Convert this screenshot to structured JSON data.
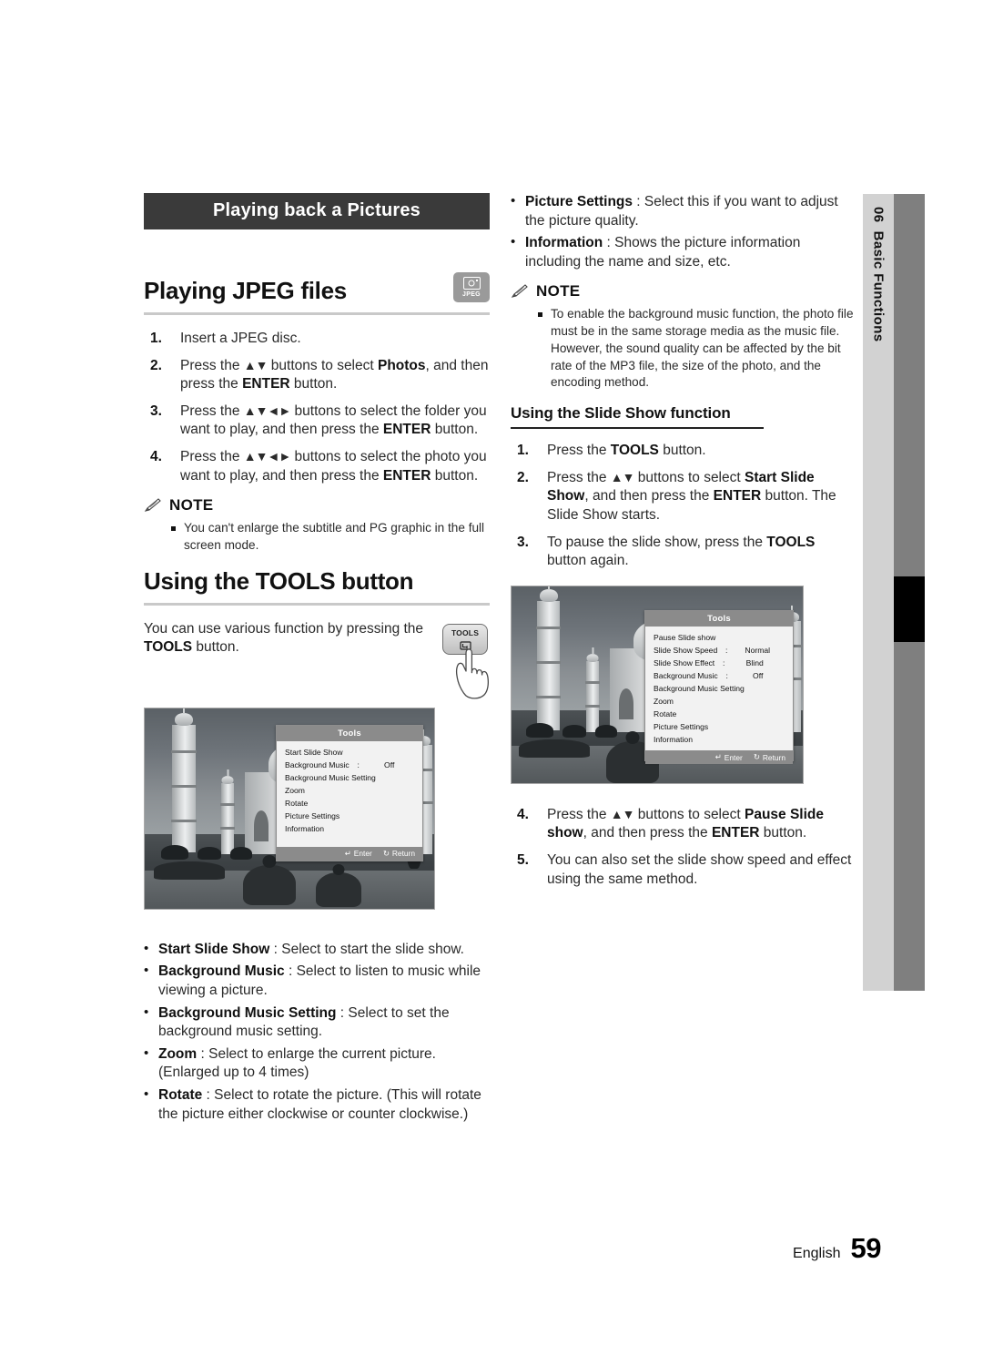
{
  "page": {
    "language_label": "English",
    "page_number": "59"
  },
  "side_tab": {
    "chapter_number": "06",
    "chapter_title": "Basic Functions"
  },
  "left_column": {
    "banner_title": "Playing back a Pictures",
    "format_badge": {
      "icon": "camera-icon",
      "label": "JPEG"
    },
    "heading_jpeg": "Playing JPEG files",
    "jpeg_steps": [
      {
        "num": "1.",
        "html": "Insert a JPEG disc."
      },
      {
        "num": "2.",
        "html": "Press the <span class=\"arrows\">▲▼</span> buttons to select <b>Photos</b>, and then press the <b>ENTER</b> button."
      },
      {
        "num": "3.",
        "html": "Press the <span class=\"arrows\">▲▼◄►</span> buttons to select the folder you want to play, and then press the <b>ENTER</b> button."
      },
      {
        "num": "4.",
        "html": "Press the <span class=\"arrows\">▲▼◄►</span> buttons to select the photo you want to play, and then press the <b>ENTER</b> button."
      }
    ],
    "note_label": "NOTE",
    "note_items": [
      "You can't enlarge the subtitle and PG graphic in the full screen mode."
    ],
    "heading_tools": "Using the TOOLS button",
    "tools_intro_html": "You can use various function by pressing the <b>TOOLS</b> button.",
    "tools_key_label": "TOOLS",
    "screenshot_menu": {
      "title": "Tools",
      "rows": [
        {
          "label": "Start Slide Show",
          "colon": "",
          "value": ""
        },
        {
          "label": "Background Music",
          "colon": ":",
          "value": "Off"
        },
        {
          "label": "Background Music Setting",
          "colon": "",
          "value": ""
        },
        {
          "label": "Zoom",
          "colon": "",
          "value": ""
        },
        {
          "label": "Rotate",
          "colon": "",
          "value": ""
        },
        {
          "label": "Picture Settings",
          "colon": "",
          "value": ""
        },
        {
          "label": "Information",
          "colon": "",
          "value": ""
        }
      ],
      "footer_enter": "Enter",
      "footer_return": "Return"
    },
    "option_bullets": [
      "<b>Start Slide Show</b> : Select to start the slide show.",
      "<b>Background Music</b> : Select to listen to music while viewing a picture.",
      "<b>Background Music Setting</b> : Select to set the background music setting.",
      "<b>Zoom</b> : Select to enlarge the current picture. (Enlarged up to 4 times)",
      "<b>Rotate</b> : Select to rotate the picture. (This will rotate the picture either clockwise or counter clockwise.)"
    ]
  },
  "right_column": {
    "option_bullets": [
      "<b>Picture Settings</b> : Select this if you want to adjust the picture quality.",
      "<b>Information</b> : Shows the picture information including the name and size, etc."
    ],
    "note_label": "NOTE",
    "note_items": [
      "To enable the background music function, the photo file must be in the same storage media as the music file. However, the sound quality can be affected by the bit rate of the MP3 file, the size of the photo, and the encoding method."
    ],
    "heading_slideshow": "Using the Slide Show function",
    "slideshow_steps": [
      {
        "num": "1.",
        "html": "Press the <b>TOOLS</b> button."
      },
      {
        "num": "2.",
        "html": "Press the <span class=\"arrows\">▲▼</span> buttons to select <b>Start Slide Show</b>, and then press the <b>ENTER</b> button. The Slide Show starts."
      },
      {
        "num": "3.",
        "html": "To pause the slide show, press the <b>TOOLS</b> button again."
      },
      {
        "num": "4.",
        "html": "Press the <span class=\"arrows\">▲▼</span> buttons to select <b>Pause Slide show</b>, and then press the <b>ENTER</b> button."
      },
      {
        "num": "5.",
        "html": "You can also set the slide show speed and effect using the same method."
      }
    ],
    "screenshot_menu": {
      "title": "Tools",
      "rows": [
        {
          "label": "Pause Slide show",
          "colon": "",
          "value": ""
        },
        {
          "label": "Slide Show Speed",
          "colon": ":",
          "value": "Normal"
        },
        {
          "label": "Slide Show Effect",
          "colon": ":",
          "value": "Blind"
        },
        {
          "label": "Background Music",
          "colon": ":",
          "value": "Off"
        },
        {
          "label": "Background Music Setting",
          "colon": "",
          "value": ""
        },
        {
          "label": "Zoom",
          "colon": "",
          "value": ""
        },
        {
          "label": "Rotate",
          "colon": "",
          "value": ""
        },
        {
          "label": "Picture Settings",
          "colon": "",
          "value": ""
        },
        {
          "label": "Information",
          "colon": "",
          "value": ""
        }
      ],
      "footer_enter": "Enter",
      "footer_return": "Return"
    }
  }
}
